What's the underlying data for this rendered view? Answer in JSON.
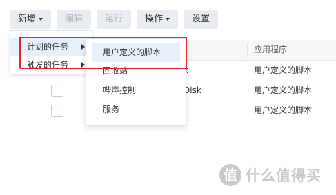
{
  "toolbar": {
    "buttons": [
      {
        "label": "新增",
        "has_caret": true,
        "enabled": true
      },
      {
        "label": "编辑",
        "has_caret": false,
        "enabled": false
      },
      {
        "label": "运行",
        "has_caret": false,
        "enabled": false
      },
      {
        "label": "操作",
        "has_caret": true,
        "enabled": true
      },
      {
        "label": "设置",
        "has_caret": false,
        "enabled": true
      }
    ]
  },
  "table": {
    "header": {
      "app_column": "应用程序"
    },
    "rows": [
      {
        "name_fragment": "k",
        "app": "用户定义的脚本",
        "has_checkbox": false
      },
      {
        "name_fragment": "Disk",
        "app": "用户定义的脚本",
        "has_checkbox": true
      },
      {
        "name_fragment": "",
        "app": "用户定义的脚本",
        "has_checkbox": true
      }
    ]
  },
  "menu_level1": {
    "items": [
      {
        "label": "计划的任务",
        "active": true
      },
      {
        "label": "触发的任务",
        "active": false
      }
    ]
  },
  "menu_level2": {
    "items": [
      {
        "label": "用户定义的脚本",
        "active": true
      },
      {
        "label": "回收站",
        "active": false
      },
      {
        "label": "哔声控制",
        "active": false
      },
      {
        "label": "服务",
        "active": false
      }
    ]
  },
  "annotation": {
    "color": "#e0292e"
  },
  "watermark": {
    "logo_char": "值",
    "text": "什么值得买"
  }
}
